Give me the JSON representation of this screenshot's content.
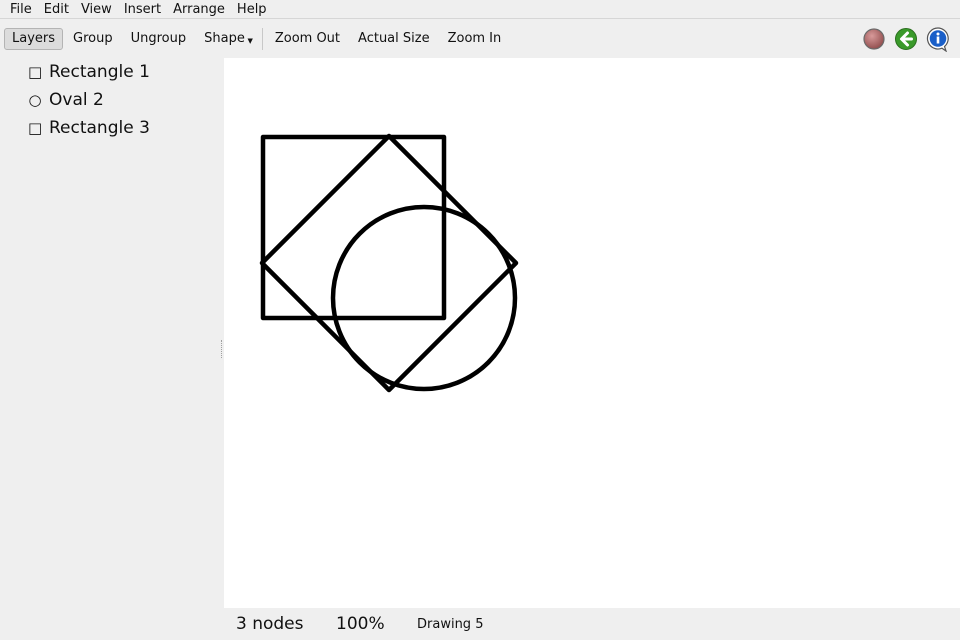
{
  "menubar": {
    "items": [
      "File",
      "Edit",
      "View",
      "Insert",
      "Arrange",
      "Help"
    ]
  },
  "toolbar": {
    "layers": "Layers",
    "group": "Group",
    "ungroup": "Ungroup",
    "shape": "Shape",
    "zoom_out": "Zoom Out",
    "actual_size": "Actual Size",
    "zoom_in": "Zoom In",
    "icons": [
      "stop-icon",
      "back-arrow-icon",
      "info-icon"
    ]
  },
  "layers": [
    {
      "glyph": "□",
      "label": "Rectangle 1"
    },
    {
      "glyph": "○",
      "label": "Oval 2"
    },
    {
      "glyph": "□",
      "label": "Rectangle 3"
    }
  ],
  "status": {
    "nodes": "3 nodes",
    "zoom": "100%",
    "document": "Drawing 5"
  },
  "colors": {
    "stroke": "#000000",
    "canvas_bg": "#ffffff",
    "chrome_bg": "#efefef",
    "back_icon": "#3a9a2a",
    "info_icon": "#1a5fc8",
    "stop_icon": "#b86a6a"
  }
}
